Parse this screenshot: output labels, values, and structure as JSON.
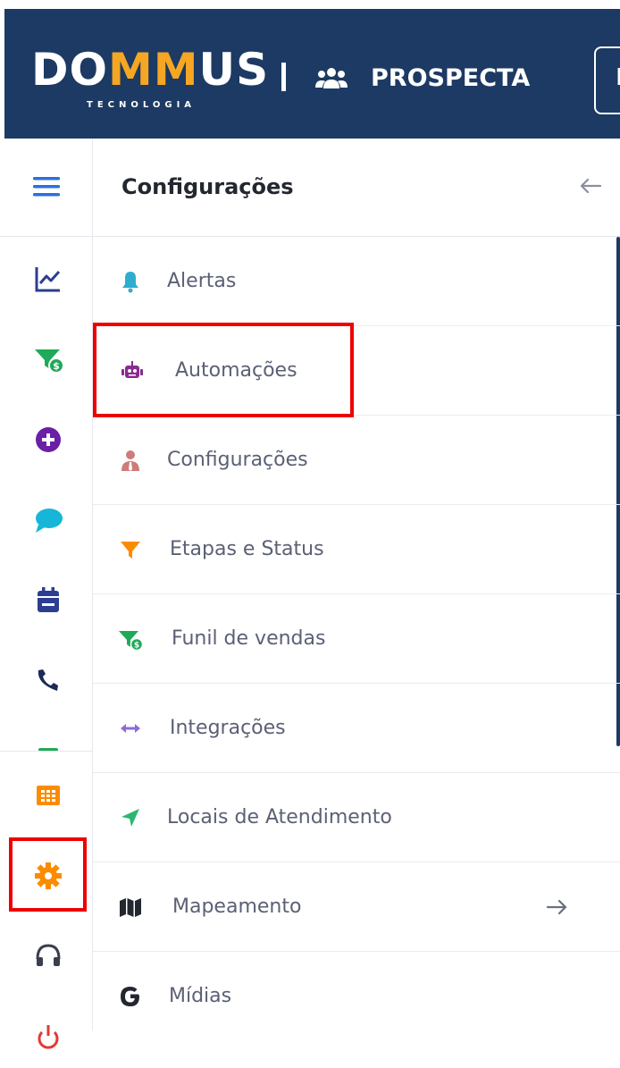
{
  "header": {
    "logo_text_pre": "DO",
    "logo_text_hl": "MM",
    "logo_text_post": "US",
    "logo_sub": "TECNOLOGIA",
    "app_name": "PROSPECTA",
    "top_button_partial": "P"
  },
  "panel": {
    "title": "Configurações"
  },
  "menu": [
    {
      "label": "Alertas",
      "icon": "bell-icon",
      "color": "#2eaecf"
    },
    {
      "label": "Automações",
      "icon": "robot-icon",
      "color": "#8a2a8f"
    },
    {
      "label": "Configurações",
      "icon": "user-tie-icon",
      "color": "#d07a7a"
    },
    {
      "label": "Etapas e Status",
      "icon": "filter-icon",
      "color": "#fb8c00"
    },
    {
      "label": "Funil de vendas",
      "icon": "funnel-dollar-icon",
      "color": "#1faa59"
    },
    {
      "label": "Integrações",
      "icon": "arrows-horizontal-icon",
      "color": "#8e6bd8"
    },
    {
      "label": "Locais de Atendimento",
      "icon": "location-arrow-icon",
      "color": "#2bb673"
    },
    {
      "label": "Mapeamento",
      "icon": "map-icon",
      "color": "#23272f"
    },
    {
      "label": "Mídias",
      "icon": "google-icon",
      "color": "#23272f"
    }
  ],
  "rail_icons": [
    "hamburger-icon",
    "chart-line-icon",
    "funnel-dollar-icon",
    "plus-circle-icon",
    "chat-icon",
    "calendar-icon",
    "phone-icon",
    "grid-icon",
    "gear-icon",
    "headset-icon",
    "power-icon"
  ],
  "colors": {
    "header_bg": "#1c3a63",
    "accent_orange": "#f5a623",
    "highlight_red": "#ee0000"
  }
}
